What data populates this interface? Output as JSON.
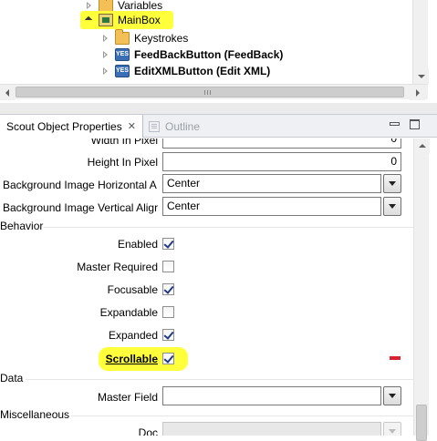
{
  "tree": {
    "items": [
      {
        "label": "Variables",
        "icon": "folder-icon",
        "bold": false
      },
      {
        "label": "MainBox",
        "icon": "main-box-icon",
        "bold": false
      },
      {
        "label": "Keystrokes",
        "icon": "folder-icon",
        "bold": false
      },
      {
        "label": "FeedBackButton (FeedBack)",
        "icon": "button-icon",
        "bold": true
      },
      {
        "label": "EditXMLButton (Edit XML)",
        "icon": "button-icon",
        "bold": true
      }
    ]
  },
  "tabs": {
    "properties": "Scout Object Properties",
    "outline": "Outline"
  },
  "properties": {
    "width_in_pixel": {
      "label": "Width In Pixel",
      "value": "0"
    },
    "height_in_pixel": {
      "label": "Height In Pixel",
      "value": "0"
    },
    "bg_image_horizontal": {
      "label": "Background Image Horizontal A",
      "value": "Center"
    },
    "bg_image_vertical": {
      "label": "Background Image Vertical Aligr",
      "value": "Center"
    },
    "behavior_section": "Behavior",
    "enabled": {
      "label": "Enabled",
      "checked": true
    },
    "master_required": {
      "label": "Master Required",
      "checked": false
    },
    "focusable": {
      "label": "Focusable",
      "checked": true
    },
    "expandable": {
      "label": "Expandable",
      "checked": false
    },
    "expanded": {
      "label": "Expanded",
      "checked": true
    },
    "scrollable": {
      "label": "Scrollable",
      "checked": true
    },
    "data_section": "Data",
    "master_field": {
      "label": "Master Field",
      "value": ""
    },
    "misc_section": "Miscellaneous",
    "doc": {
      "label": "Doc",
      "value": ""
    }
  },
  "colors": {
    "highlight": "#ffff3c",
    "modified_marker": "#d6232f"
  }
}
